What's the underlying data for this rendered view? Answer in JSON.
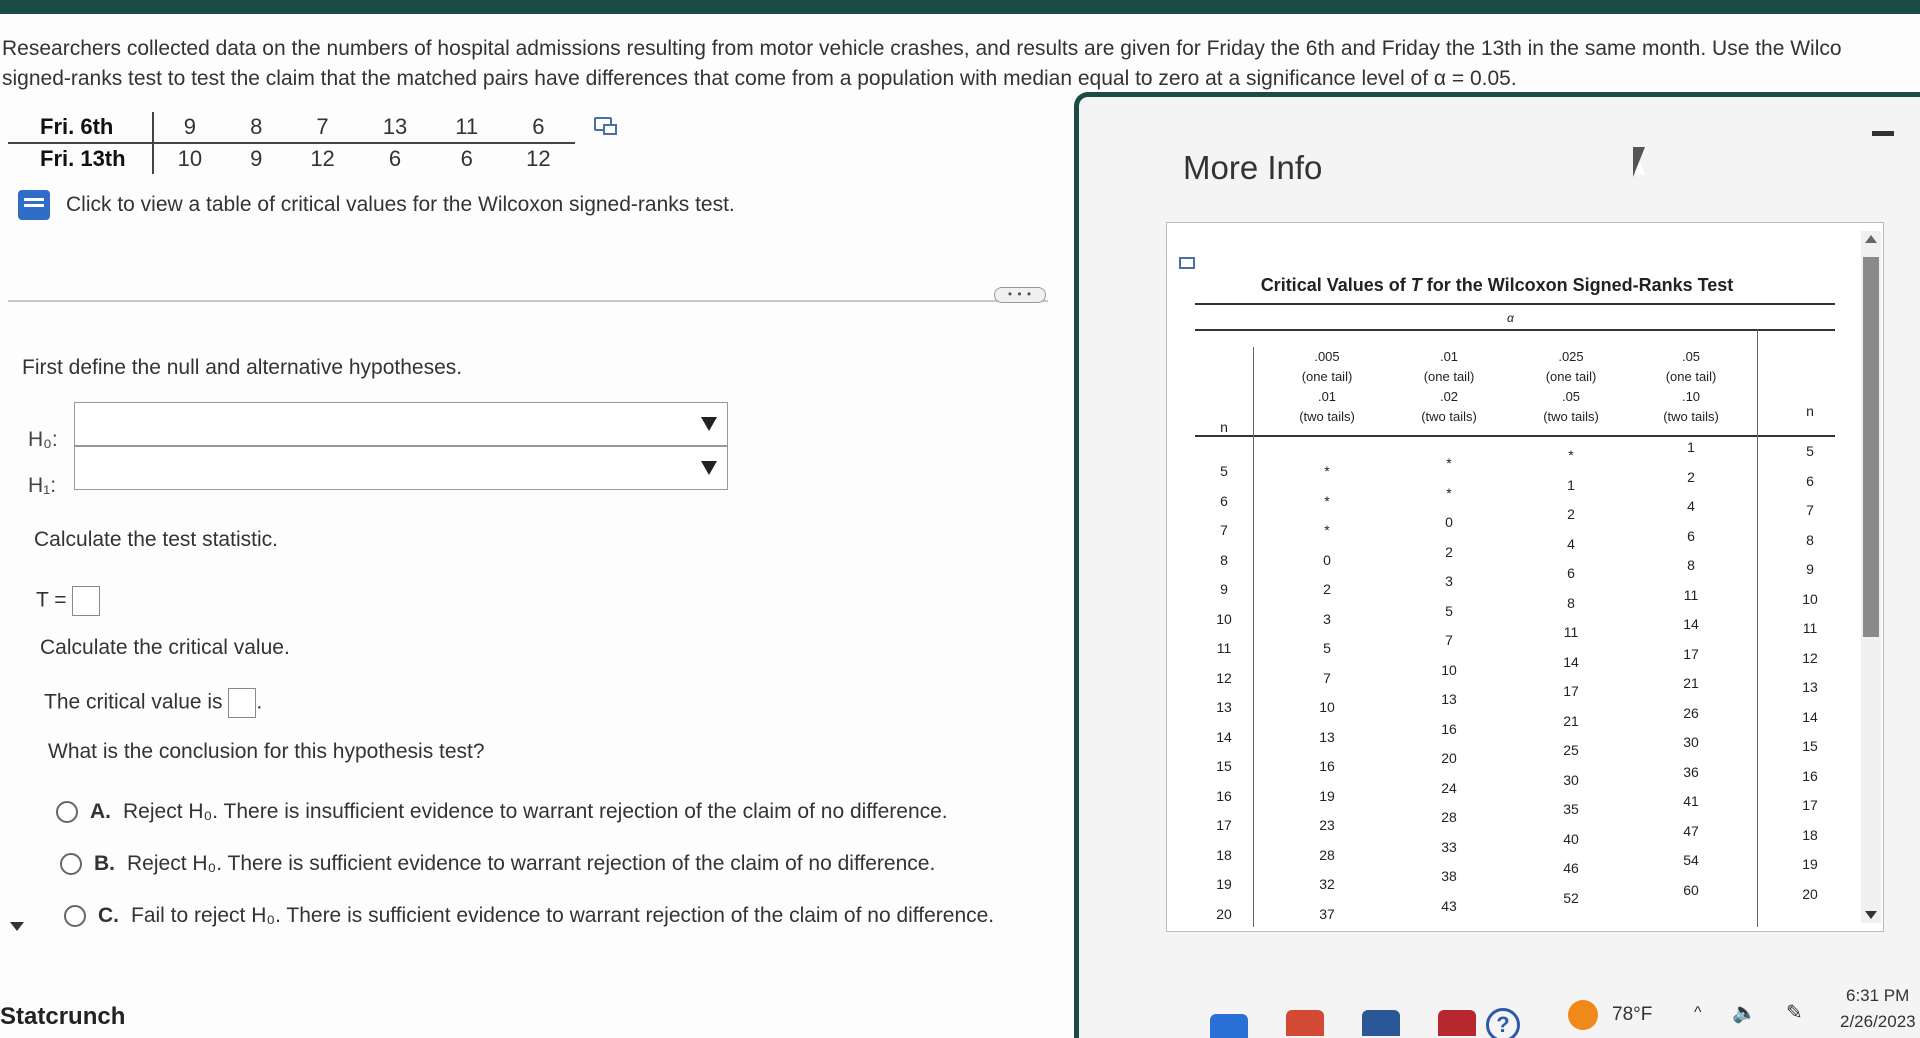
{
  "problem": {
    "line1": "Researchers collected data on the numbers of hospital admissions resulting from motor vehicle crashes, and results are given for Friday the 6th and Friday the 13th in the same month. Use the Wilco",
    "line2": "signed-ranks test to test the claim that the matched pairs have differences that come from a population with median equal to zero at a significance level of α = 0.05."
  },
  "pairs": {
    "row1_label": "Fri. 6th",
    "row1": [
      "9",
      "8",
      "7",
      "13",
      "11",
      "6"
    ],
    "row2_label": "Fri. 13th",
    "row2": [
      "10",
      "9",
      "12",
      "6",
      "6",
      "12"
    ]
  },
  "table_link": "Click to view a table of critical values for the Wilcoxon signed-ranks test.",
  "more_dots": "• • •",
  "questions": {
    "define": "First define the null and alternative hypotheses.",
    "h0_label": "H₀:",
    "h1_label": "H₁:",
    "h0_value": "",
    "h1_value": "",
    "calc_stat": "Calculate the test statistic.",
    "t_label": "T =",
    "calc_crit": "Calculate the critical value.",
    "crit_prefix": "The critical value is",
    "crit_suffix": ".",
    "conclusion": "What is the conclusion for this hypothesis test?"
  },
  "options": [
    {
      "letter": "A.",
      "text": "Reject H₀. There is insufficient evidence to warrant rejection of the claim of no difference."
    },
    {
      "letter": "B.",
      "text": "Reject H₀. There is sufficient evidence to warrant rejection of the claim of no difference."
    },
    {
      "letter": "C.",
      "text": "Fail to reject H₀. There is sufficient evidence to warrant rejection of the claim of no difference."
    }
  ],
  "brand": "Statcrunch",
  "modal": {
    "title": "More Info",
    "table_title_pre": "Critical Values of ",
    "table_title_var": "T",
    "table_title_post": " for the Wilcoxon Signed-Ranks Test",
    "alpha_symbol": "α",
    "n_header": "n",
    "n_header_right": "n",
    "col_headers": [
      {
        "a": ".005",
        "b": "(one tail)",
        "c": ".01",
        "d": "(two tails)"
      },
      {
        "a": ".01",
        "b": "(one tail)",
        "c": ".02",
        "d": "(two tails)"
      },
      {
        "a": ".025",
        "b": "(one tail)",
        "c": ".05",
        "d": "(two tails)"
      },
      {
        "a": ".05",
        "b": "(one tail)",
        "c": ".10",
        "d": "(two tails)"
      }
    ],
    "n_values": [
      "5",
      "6",
      "7",
      "8",
      "9",
      "10",
      "11",
      "12",
      "13",
      "14",
      "15",
      "16",
      "17",
      "18",
      "19",
      "20"
    ],
    "columns": [
      [
        "*",
        "*",
        "*",
        "0",
        "2",
        "3",
        "5",
        "7",
        "10",
        "13",
        "16",
        "19",
        "23",
        "28",
        "32",
        "37"
      ],
      [
        "*",
        "*",
        "0",
        "2",
        "3",
        "5",
        "7",
        "10",
        "13",
        "16",
        "20",
        "24",
        "28",
        "33",
        "38",
        "43"
      ],
      [
        "*",
        "1",
        "2",
        "4",
        "6",
        "8",
        "11",
        "14",
        "17",
        "21",
        "25",
        "30",
        "35",
        "40",
        "46",
        "52"
      ],
      [
        "1",
        "2",
        "4",
        "6",
        "8",
        "11",
        "14",
        "17",
        "21",
        "26",
        "30",
        "36",
        "41",
        "47",
        "54",
        "60"
      ]
    ]
  },
  "taskbar": {
    "temperature": "78°F",
    "time": "6:31 PM",
    "date": "2/26/2023",
    "help": "?"
  }
}
